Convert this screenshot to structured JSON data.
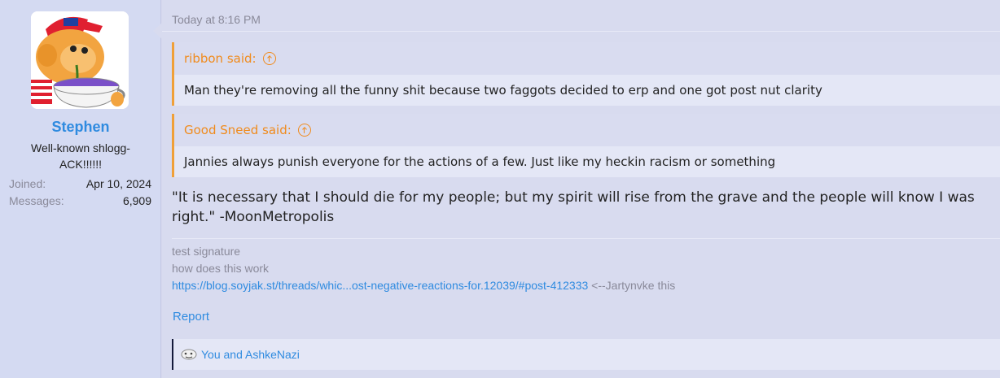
{
  "user": {
    "name": "Stephen",
    "title": "Well-known shlogg-ACK!!!!!!",
    "stats": [
      {
        "key": "Joined:",
        "value": "Apr 10, 2024"
      },
      {
        "key": "Messages:",
        "value": "6,909"
      }
    ]
  },
  "post": {
    "timestamp": "Today at 8:16 PM",
    "quotes": [
      {
        "author": "ribbon said:",
        "text": "Man they're removing all the funny shit because two faggots decided to erp and one got post nut clarity"
      },
      {
        "author": "Good Sneed said:",
        "text": "Jannies always punish everyone for the actions of a few. Just like my heckin racism or something"
      }
    ],
    "message": "\"It is necessary that I should die for my people; but my spirit will rise from the grave and the people will know I was right.\" -MoonMetropolis",
    "signature": {
      "line1": "test signature",
      "line2": "how does this work",
      "link": "https://blog.soyjak.st/threads/whic...ost-negative-reactions-for.12039/#post-412333",
      "suffix": " <--Jartynvke this"
    },
    "report_label": "Report",
    "reactions_text": "You and AshkeNazi"
  },
  "colors": {
    "link": "#2f8be0",
    "quote_accent": "#f0a038",
    "background": "#d8dbef"
  },
  "icons": {
    "quote_jump": "arrow-up-circle-icon",
    "reaction": "reaction-icon"
  }
}
